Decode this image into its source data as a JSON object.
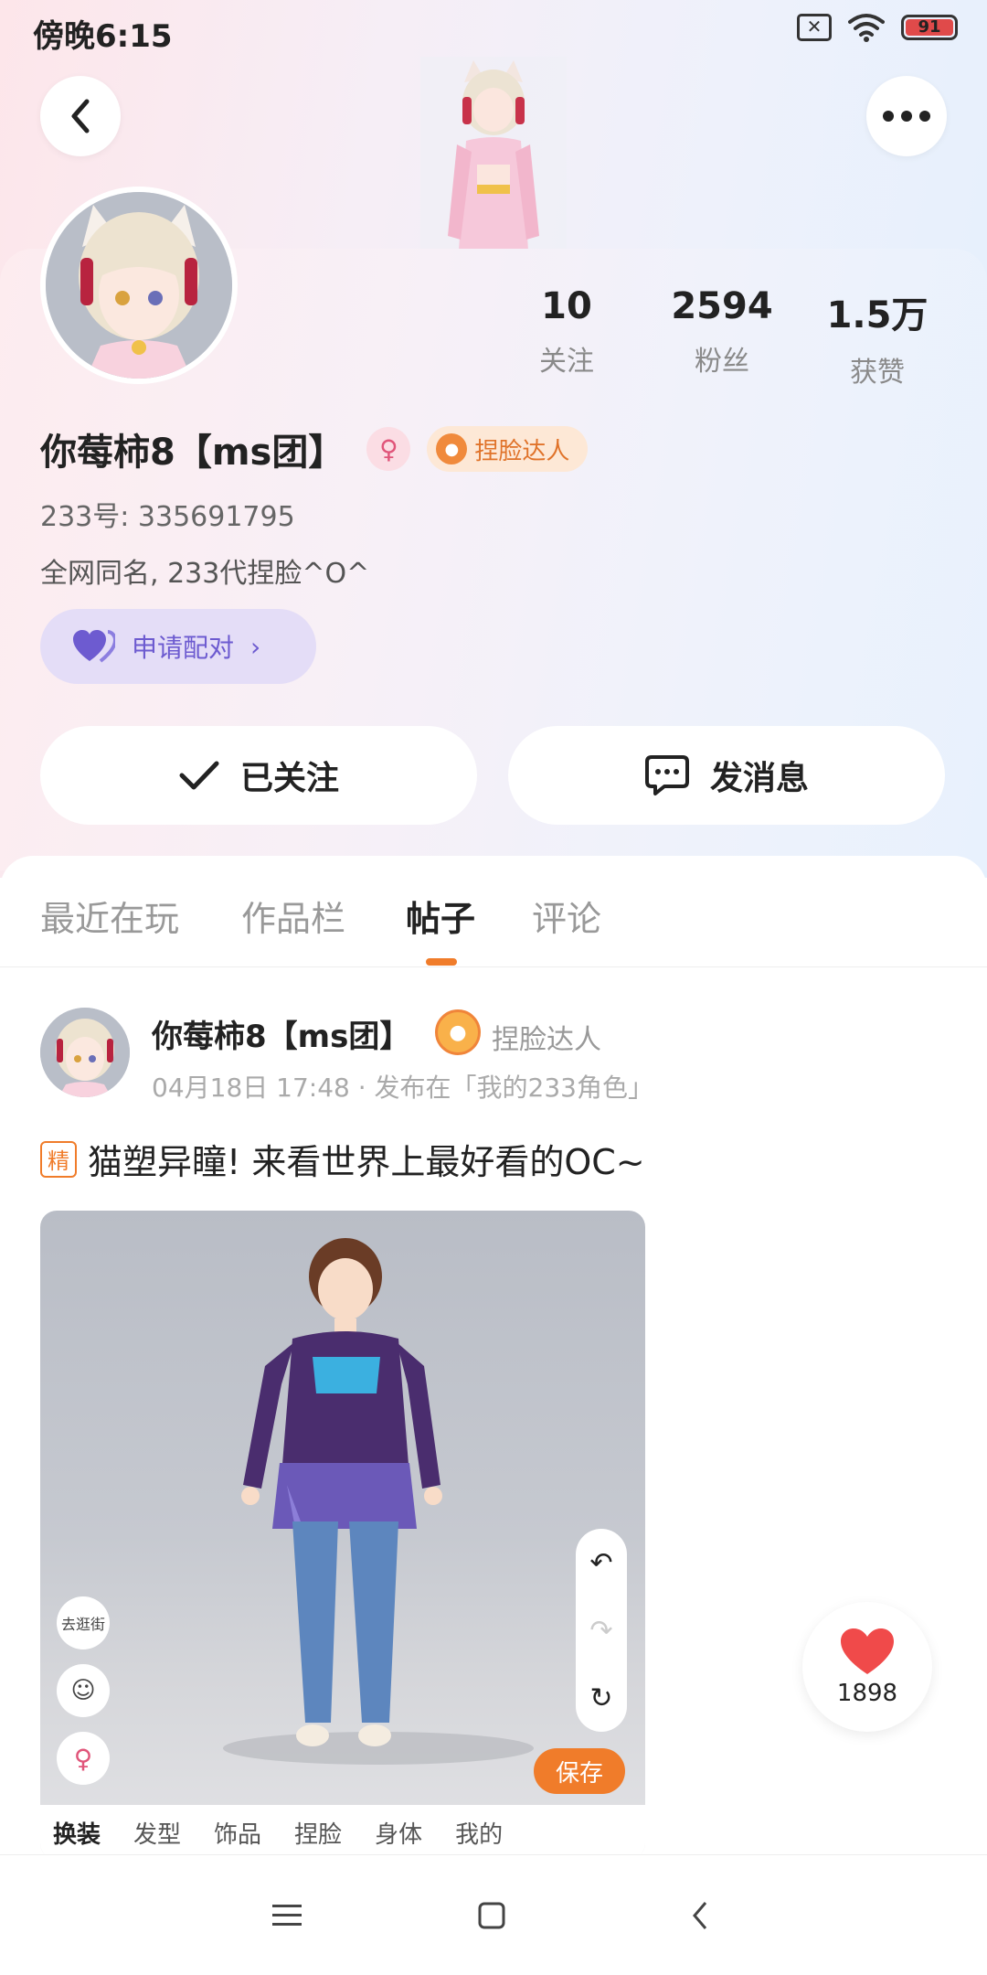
{
  "status_bar": {
    "time": "傍晚6:15",
    "battery": "91"
  },
  "profile": {
    "stats": [
      {
        "value": "10",
        "label": "关注"
      },
      {
        "value": "2594",
        "label": "粉丝"
      },
      {
        "value": "1.5万",
        "label": "获赞"
      }
    ],
    "name": "你莓柿8【ms团】",
    "title_badge": "捏脸达人",
    "user_id": "233号: 335691795",
    "bio": "全网同名, 233代捏脸^O^",
    "pair_button": "申请配对",
    "follow_button": "已关注",
    "message_button": "发消息"
  },
  "tabs": [
    {
      "label": "最近在玩",
      "active": false
    },
    {
      "label": "作品栏",
      "active": false
    },
    {
      "label": "帖子",
      "active": true
    },
    {
      "label": "评论",
      "active": false
    }
  ],
  "post": {
    "author": "你莓柿8【ms团】",
    "badge": "捏脸达人",
    "meta": "04月18日 17:48 · 发布在「我的233角色」",
    "featured_tag": "精",
    "title": "猫塑异瞳! 来看世界上最好看的OC~",
    "image": {
      "shop_label": "去逛街",
      "save_label": "保存",
      "tabs": [
        "换装",
        "发型",
        "饰品",
        "捏脸",
        "身体",
        "我的"
      ]
    },
    "likes": "1898"
  },
  "colors": {
    "accent": "#f07c2a",
    "pair": "#6d5bd0",
    "heart": "#f04a4a"
  }
}
